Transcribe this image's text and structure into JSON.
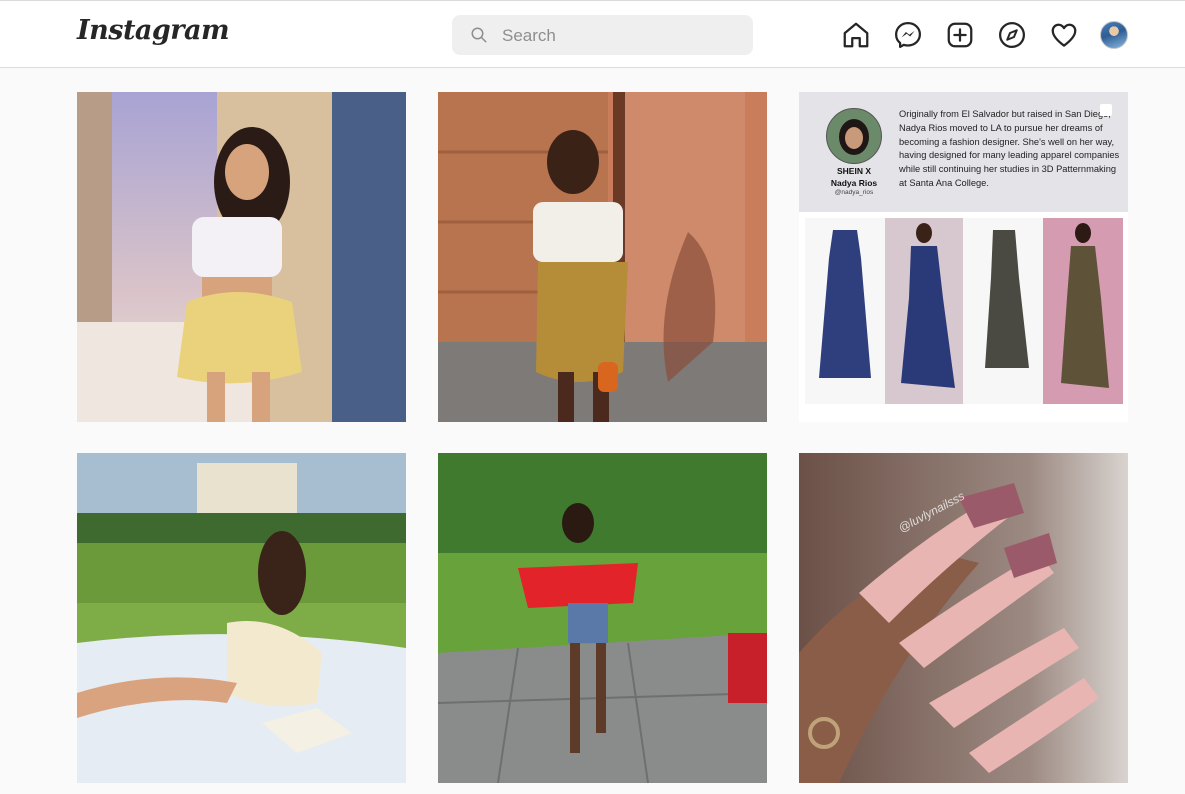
{
  "header": {
    "logo": "Instagram",
    "search": {
      "placeholder": "Search",
      "value": ""
    }
  },
  "nav": {
    "icons": [
      "home-icon",
      "messenger-icon",
      "new-post-icon",
      "explore-icon",
      "activity-heart-icon",
      "profile-avatar"
    ]
  },
  "colors": {
    "page_bg": "#fafafa",
    "header_bg": "#ffffff",
    "search_bg": "#efefef",
    "icon": "#262626",
    "border": "#dbdbdb"
  },
  "posts": [
    {
      "type": "photo"
    },
    {
      "type": "photo"
    },
    {
      "type": "designer-feature",
      "brand_mark": "SHEIN X",
      "designer_name": "Nadya Rios",
      "designer_handle": "@nadya_rios",
      "bio": "Originally from El Salvador but raised in San Diego, Nadya Rios moved to LA to pursue her dreams of becoming a fashion designer. She's well on her way, having designed for many leading apparel companies while still continuing her studies in 3D Patternmaking at Santa Ana College."
    },
    {
      "type": "photo"
    },
    {
      "type": "photo"
    },
    {
      "type": "photo",
      "watermark": "@luvlynailsss"
    }
  ]
}
